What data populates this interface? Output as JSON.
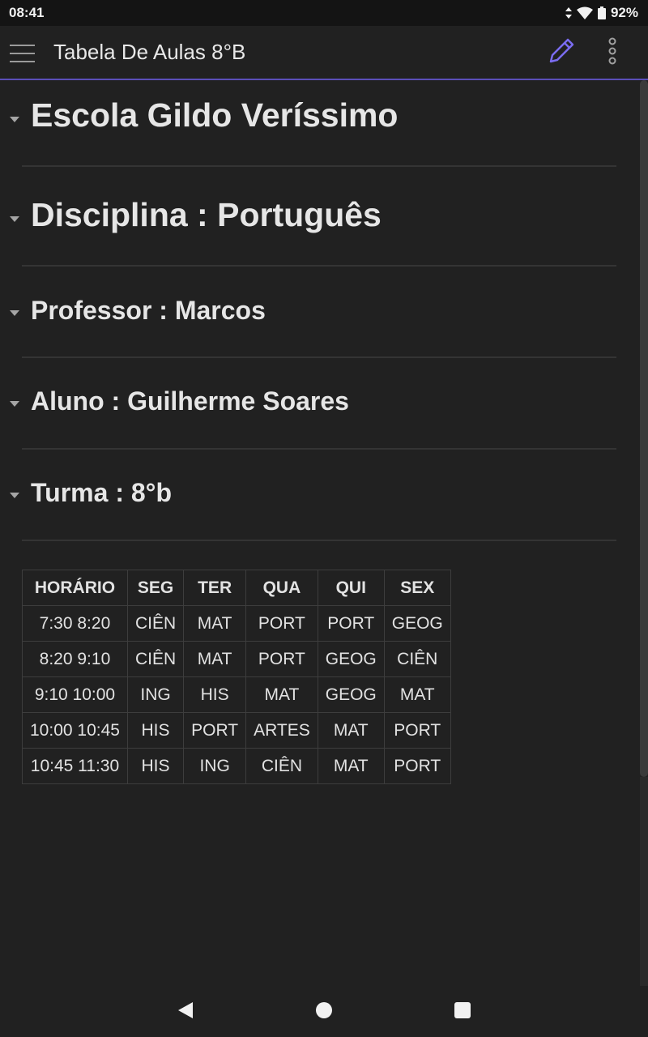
{
  "status_bar": {
    "time": "08:41",
    "battery": "92%",
    "icons": [
      "data-arrows-icon",
      "wifi-icon",
      "battery-icon"
    ]
  },
  "app_bar": {
    "title": "Tabela De Aulas 8°B",
    "icons": [
      "menu-icon",
      "pencil-icon",
      "more-vert-icon"
    ],
    "accent_color": "#7a6cf0"
  },
  "sections": [
    {
      "heading": "Escola Gildo Veríssimo"
    },
    {
      "heading": "Disciplina : Português"
    },
    {
      "heading": "Professor : Marcos"
    },
    {
      "heading": "Aluno : Guilherme Soares"
    },
    {
      "heading": "Turma : 8°b"
    }
  ],
  "schedule": {
    "headers": [
      "HORÁRIO",
      "SEG",
      "TER",
      "QUA",
      "QUI",
      "SEX"
    ],
    "rows": [
      [
        "7:30 8:20",
        "CIÊN",
        "MAT",
        "PORT",
        "PORT",
        "GEOG"
      ],
      [
        "8:20 9:10",
        "CIÊN",
        "MAT",
        "PORT",
        "GEOG",
        "CIÊN"
      ],
      [
        "9:10 10:00",
        "ING",
        "HIS",
        "MAT",
        "GEOG",
        "MAT"
      ],
      [
        "10:00 10:45",
        "HIS",
        "PORT",
        "ARTES",
        "MAT",
        "PORT"
      ],
      [
        "10:45 11:30",
        "HIS",
        "ING",
        "CIÊN",
        "MAT",
        "PORT"
      ]
    ]
  },
  "nav_bar": {
    "icons": [
      "back-icon",
      "home-icon",
      "recents-icon"
    ]
  }
}
